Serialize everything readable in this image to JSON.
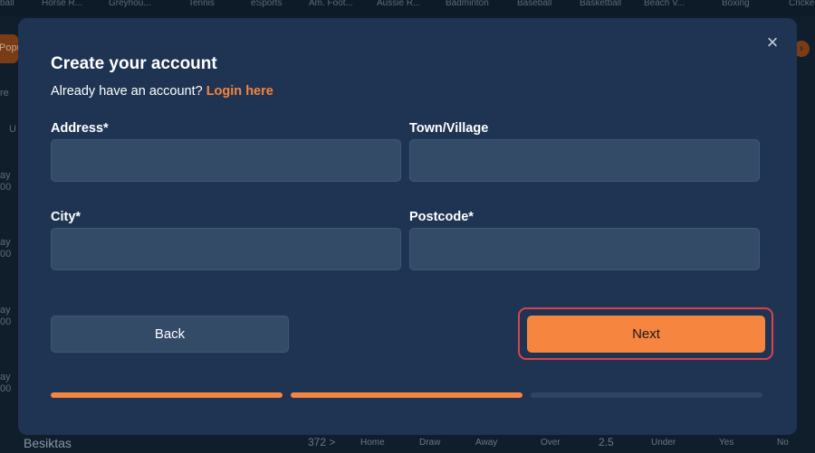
{
  "background": {
    "top_nav": [
      "ball",
      "Horse R...",
      "Greyhou...",
      "Tennis",
      "eSports",
      "Am. Foot...",
      "Aussie R...",
      "Badminton",
      "Baseball",
      "Basketball",
      "Beach V...",
      "Boxing",
      "Cricke"
    ],
    "popular_label": "Popular",
    "left_fragments": [
      "re",
      "U",
      "ay",
      "00",
      "ay",
      "00",
      "ay",
      "00",
      "ay",
      "00"
    ],
    "footer": {
      "team": "Besiktas",
      "markets_count": "372 >",
      "home": "Home",
      "draw": "Draw",
      "away": "Away",
      "over": "Over",
      "line": "2.5",
      "under": "Under",
      "yes": "Yes",
      "no": "No"
    }
  },
  "modal": {
    "title": "Create your account",
    "subtitle_prefix": "Already have an account? ",
    "login_link": "Login here",
    "fields": {
      "address": {
        "label": "Address*",
        "value": "",
        "placeholder": ""
      },
      "town": {
        "label": "Town/Village",
        "value": "",
        "placeholder": ""
      },
      "city": {
        "label": "City*",
        "value": "",
        "placeholder": ""
      },
      "postcode": {
        "label": "Postcode*",
        "value": "",
        "placeholder": ""
      }
    },
    "back_label": "Back",
    "next_label": "Next",
    "close_glyph": "×",
    "progress": {
      "steps_total": 3,
      "steps_completed": 2
    }
  },
  "colors": {
    "accent": "#f5853f",
    "modal_bg": "#1e3452",
    "input_bg": "#334b66",
    "focus_ring": "#d9434d",
    "progress_inactive": "#2d4560"
  }
}
